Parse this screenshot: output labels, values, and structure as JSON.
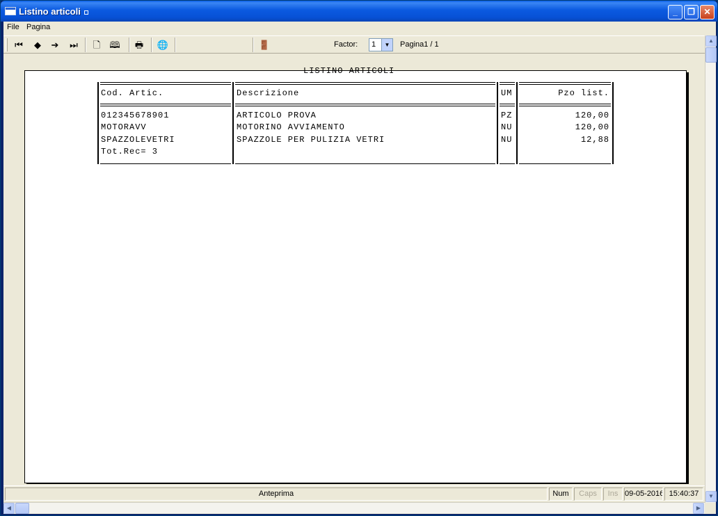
{
  "window": {
    "title": "Listino articoli"
  },
  "menu": [
    "File",
    "Pagina"
  ],
  "toolbar": {
    "factor_label": "Factor:",
    "factor_value": "1",
    "page_info": "Pagina1 / 1"
  },
  "report": {
    "title": "LISTINO ARTICOLI",
    "headers": {
      "code": "Cod. Artic.",
      "desc": "Descrizione",
      "um": "UM",
      "price": "Pzo list."
    },
    "rows": [
      {
        "code": "012345678901",
        "desc": "ARTICOLO PROVA",
        "um": "PZ",
        "price": "120,00"
      },
      {
        "code": "MOTORAVV",
        "desc": "MOTORINO AVVIAMENTO",
        "um": "NU",
        "price": "120,00"
      },
      {
        "code": "SPAZZOLEVETRI",
        "desc": "SPAZZOLE PER PULIZIA VETRI",
        "um": "NU",
        "price": "12,88"
      }
    ],
    "total": "Tot.Rec= 3"
  },
  "status": {
    "mode": "Anteprima",
    "num": "Num",
    "caps": "Caps",
    "ins": "Ins",
    "date": "09-05-2016",
    "time": "15:40:37"
  }
}
